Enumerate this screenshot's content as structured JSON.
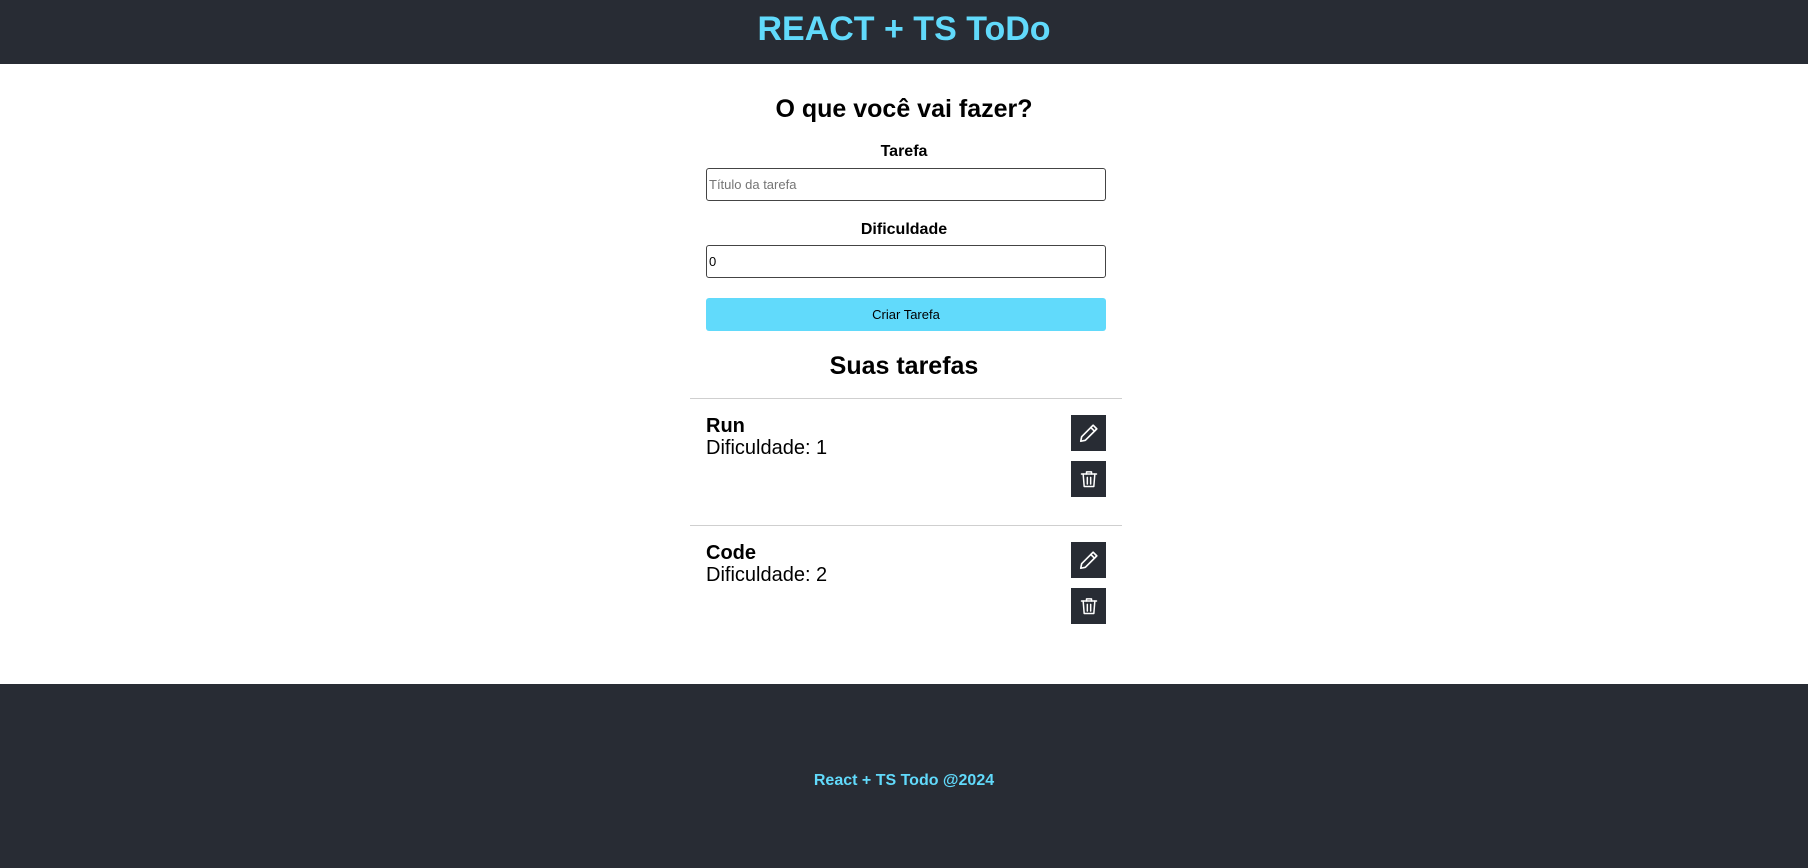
{
  "header": {
    "title": "REACT + TS ToDo"
  },
  "form": {
    "title": "O que você vai fazer?",
    "task_label": "Tarefa",
    "task_placeholder": "Título da tarefa",
    "task_value": "",
    "difficulty_label": "Dificuldade",
    "difficulty_value": "0",
    "submit_label": "Criar Tarefa"
  },
  "list": {
    "title": "Suas tarefas",
    "tasks": [
      {
        "title": "Run",
        "difficulty_text": "Dificuldade: 1",
        "edit_icon": "pencil-icon",
        "delete_icon": "trash-icon"
      },
      {
        "title": "Code",
        "difficulty_text": "Dificuldade: 2",
        "edit_icon": "pencil-icon",
        "delete_icon": "trash-icon"
      }
    ]
  },
  "footer": {
    "text": "React + TS Todo @2024"
  },
  "colors": {
    "dark": "#282c34",
    "accent": "#61dafb"
  }
}
